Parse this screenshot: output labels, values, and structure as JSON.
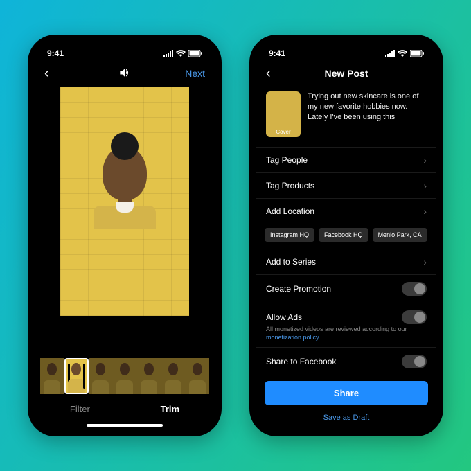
{
  "status": {
    "time": "9:41"
  },
  "phone1": {
    "nav": {
      "next": "Next"
    },
    "tabs": {
      "filter": "Filter",
      "trim": "Trim"
    }
  },
  "phone2": {
    "nav": {
      "title": "New Post"
    },
    "caption": "Trying out new skincare is one of my new favorite hobbies now. Lately I've been using this",
    "cover_label": "Cover",
    "rows": {
      "tag_people": "Tag People",
      "tag_products": "Tag Products",
      "add_location": "Add Location",
      "add_to_series": "Add to Series",
      "create_promotion": "Create Promotion",
      "allow_ads": "Allow Ads",
      "share_facebook": "Share to Facebook"
    },
    "location_chips": [
      "Instagram HQ",
      "Facebook HQ",
      "Menlo Park, CA"
    ],
    "ads_sub_prefix": "All monetized videos are reviewed according to our ",
    "ads_sub_link": "monetization policy",
    "share_btn": "Share",
    "save_draft": "Save as Draft"
  }
}
